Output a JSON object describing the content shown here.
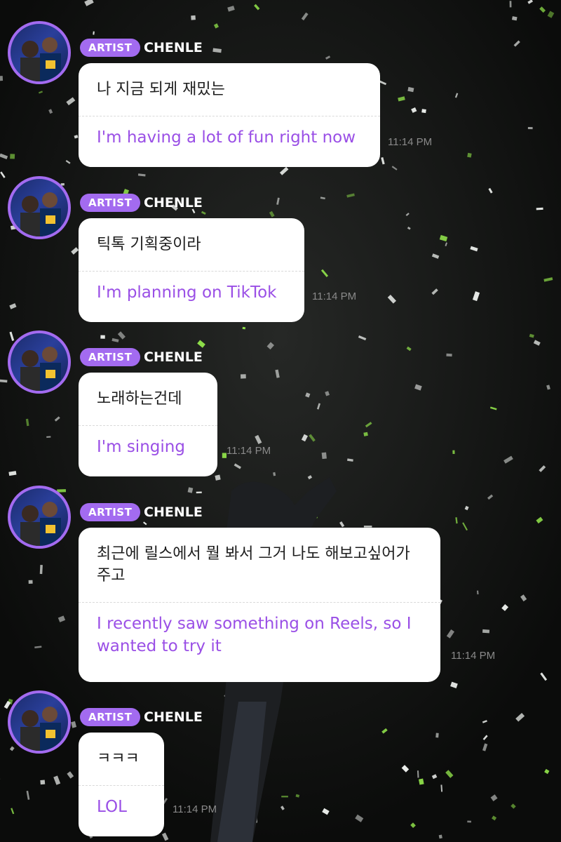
{
  "messages": [
    {
      "badge": "ARTIST",
      "name": "CHENLE",
      "ko": "나 지금 되게 재밌는",
      "en": "I'm having a lot of fun right now",
      "time": "11:14 PM"
    },
    {
      "badge": "ARTIST",
      "name": "CHENLE",
      "ko": "틱톡 기획중이라",
      "en": "I'm planning on TikTok",
      "time": "11:14 PM"
    },
    {
      "badge": "ARTIST",
      "name": "CHENLE",
      "ko": "노래하는건데",
      "en": "I'm singing",
      "time": "11:14 PM"
    },
    {
      "badge": "ARTIST",
      "name": "CHENLE",
      "ko": "최근에 릴스에서 뭘 봐서 그거 나도 해보고싶어가주고",
      "en": "I recently saw something on Reels, so I wanted to try it",
      "time": "11:14 PM"
    },
    {
      "badge": "ARTIST",
      "name": "CHENLE",
      "ko": "ㅋㅋㅋ",
      "en": "LOL",
      "time": "11:14 PM"
    }
  ],
  "colors": {
    "accent": "#a36bf0",
    "translation": "#9a4fe6",
    "bubble": "#ffffff",
    "background": "#0e0f0e"
  },
  "icons": {
    "avatar": "profile-photo"
  }
}
